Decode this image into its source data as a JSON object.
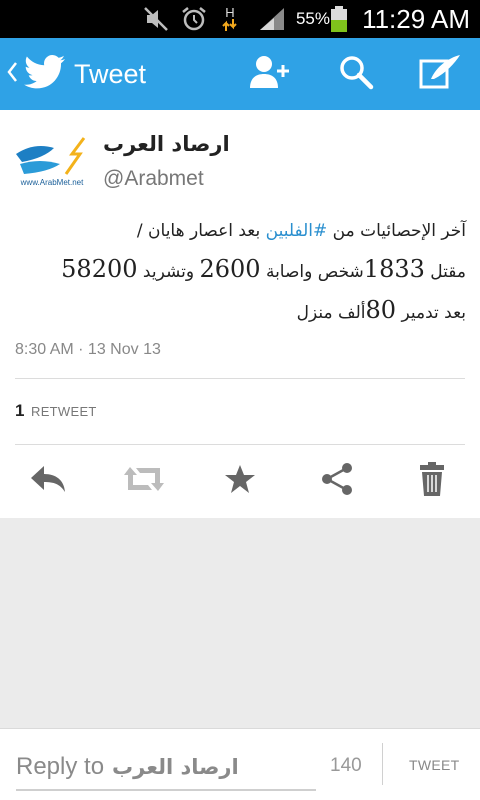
{
  "status_bar": {
    "time": "11:29 AM",
    "battery_percent": "55%",
    "network_label": "H",
    "icons": [
      "mute-icon",
      "alarm-icon",
      "data-arrows-icon",
      "signal-icon",
      "battery-icon"
    ]
  },
  "action_bar": {
    "title": "Tweet",
    "color": "#2fa2e6",
    "icons": [
      "back-chevron-icon",
      "twitter-bird-icon",
      "add-user-icon",
      "search-icon",
      "compose-icon"
    ]
  },
  "tweet": {
    "author_name": "ارصاد العرب",
    "author_handle": "@Arabmet",
    "text_line1_before": "آخر الإحصائيات من ",
    "hashtag": "#الفلبين",
    "text_line1_after": " بعد اعصار هايان /",
    "line2_a": "مقتل ",
    "num_1833": "1833",
    "line2_b": "شخص واصابة ",
    "num_2600": "2600",
    "line2_c": " وتشريد ",
    "num_58200": "58200",
    "line3_a": "بعد تدمير ",
    "num_80": "80",
    "line3_b": "ألف منزل",
    "timestamp": "8:30 AM · 13 Nov 13",
    "retweet_count": "1",
    "retweet_label": "RETWEET",
    "hashtag_color": "#2a8fcf"
  },
  "actions": [
    "reply-icon",
    "retweet-icon",
    "favorite-icon",
    "share-icon",
    "delete-icon"
  ],
  "reply": {
    "placeholder_prefix": "Reply to",
    "placeholder_name": "ارصاد العرب",
    "char_count": "140",
    "tweet_button": "TWEET"
  }
}
